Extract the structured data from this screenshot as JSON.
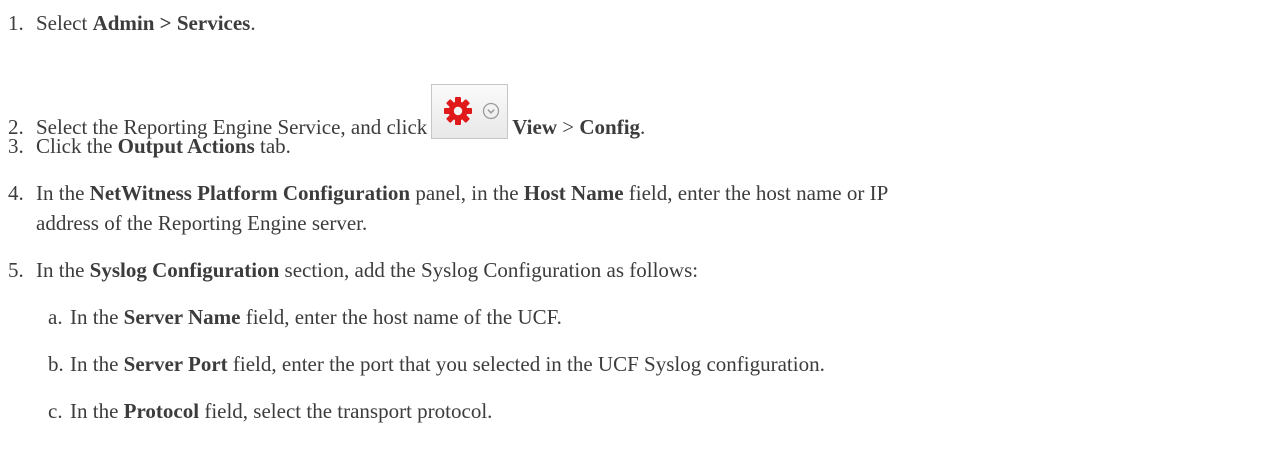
{
  "steps": [
    {
      "num": "1.",
      "pre": "Select ",
      "b1": "Admin > Services",
      "post": "."
    },
    {
      "num": "2.",
      "pre": "Select the Reporting Engine Service, and click",
      "b1": "View",
      "mid": " > ",
      "b2": "Config",
      "post": ".",
      "icon": "gear-dropdown-icon"
    },
    {
      "num": "3.",
      "pre": "Click the ",
      "b1": "Output Actions",
      "post": " tab."
    },
    {
      "num": "4.",
      "pre": "In the ",
      "b1": "NetWitness Platform Configuration",
      "mid1": " panel, in the ",
      "b2": "Host Name",
      "mid2": " field, enter the host name or IP",
      "line2": "address of the Reporting Engine server."
    },
    {
      "num": "5.",
      "pre": "In the ",
      "b1": "Syslog Configuration",
      "post": " section, add the Syslog Configuration as follows:"
    }
  ],
  "substeps": [
    {
      "letter": "a.",
      "pre": "In the ",
      "b1": "Server Name",
      "post": " field, enter the host name of the UCF."
    },
    {
      "letter": "b.",
      "pre": "In the ",
      "b1": "Server Port",
      "post": " field, enter the port that you selected in the UCF Syslog configuration."
    },
    {
      "letter": "c.",
      "pre": "In the ",
      "b1": "Protocol",
      "post": " field, select the transport protocol."
    }
  ],
  "colors": {
    "text": "#3c3c3c",
    "gear": "#e01a1a",
    "chevron": "#9a9a9a"
  }
}
